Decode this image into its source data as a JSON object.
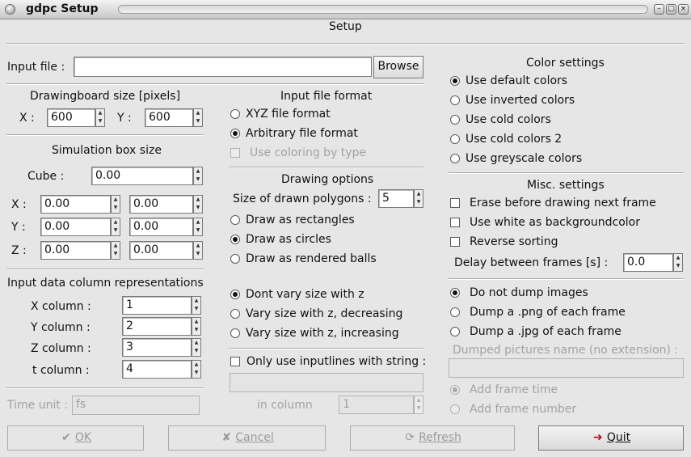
{
  "window": {
    "title": "gdpc Setup",
    "heading": "Setup"
  },
  "input_file": {
    "label": "Input file :",
    "value": "",
    "browse_label": "Browse"
  },
  "drawingboard": {
    "title": "Drawingboard size [pixels]",
    "x_label": "X :",
    "x_value": "600",
    "y_label": "Y :",
    "y_value": "600"
  },
  "simbox": {
    "title": "Simulation box size",
    "cube_label": "Cube :",
    "cube_value": "0.00",
    "x_label": "X :",
    "x_min": "0.00",
    "x_max": "0.00",
    "y_label": "Y :",
    "y_min": "0.00",
    "y_max": "0.00",
    "z_label": "Z :",
    "z_min": "0.00",
    "z_max": "0.00"
  },
  "columns": {
    "title": "Input data column representations",
    "x_label": "X column :",
    "x_value": "1",
    "y_label": "Y column :",
    "y_value": "2",
    "z_label": "Z column :",
    "z_value": "3",
    "t_label": "t column :",
    "t_value": "4"
  },
  "time_unit": {
    "label": "Time unit :",
    "value": "fs"
  },
  "input_format": {
    "title": "Input file format",
    "xyz": "XYZ file format",
    "arbitrary": "Arbitrary file format",
    "coloring": "Use coloring by type",
    "selected": "arbitrary"
  },
  "drawing_options": {
    "title": "Drawing options",
    "size_label": "Size of drawn polygons :",
    "size_value": "5",
    "rectangles": "Draw as rectangles",
    "circles": "Draw as circles",
    "balls": "Draw as rendered balls",
    "selected_shape": "circles",
    "dont_vary": "Dont vary size with z",
    "vary_dec": "Vary size with z, decreasing",
    "vary_inc": "Vary size with z, increasing",
    "selected_size": "dont_vary"
  },
  "inputlines": {
    "label": "Only use inputlines with string :",
    "string_value": "",
    "column_label": "in column",
    "column_value": "1"
  },
  "color_settings": {
    "title": "Color settings",
    "default": "Use default colors",
    "inverted": "Use inverted colors",
    "cold": "Use cold colors",
    "cold2": "Use cold colors 2",
    "grey": "Use greyscale colors",
    "selected": "default"
  },
  "misc": {
    "title": "Misc. settings",
    "erase": "Erase before drawing next frame",
    "white_bg": "Use white as backgroundcolor",
    "reverse": "Reverse sorting",
    "delay_label": "Delay between frames [s] :",
    "delay_value": "0.0"
  },
  "dump": {
    "none": "Do not dump images",
    "png": "Dump a .png of each frame",
    "jpg": "Dump a .jpg of each frame",
    "selected": "none",
    "name_label": "Dumped pictures name (no extension) :",
    "name_value": "",
    "frame_time": "Add frame time",
    "frame_number": "Add frame number"
  },
  "buttons": {
    "ok": "OK",
    "cancel": "Cancel",
    "refresh": "Refresh",
    "quit": "Quit"
  },
  "icons": {
    "ok": "check-icon",
    "cancel": "x-icon",
    "refresh": "refresh-icon",
    "quit": "exit-door-icon"
  }
}
